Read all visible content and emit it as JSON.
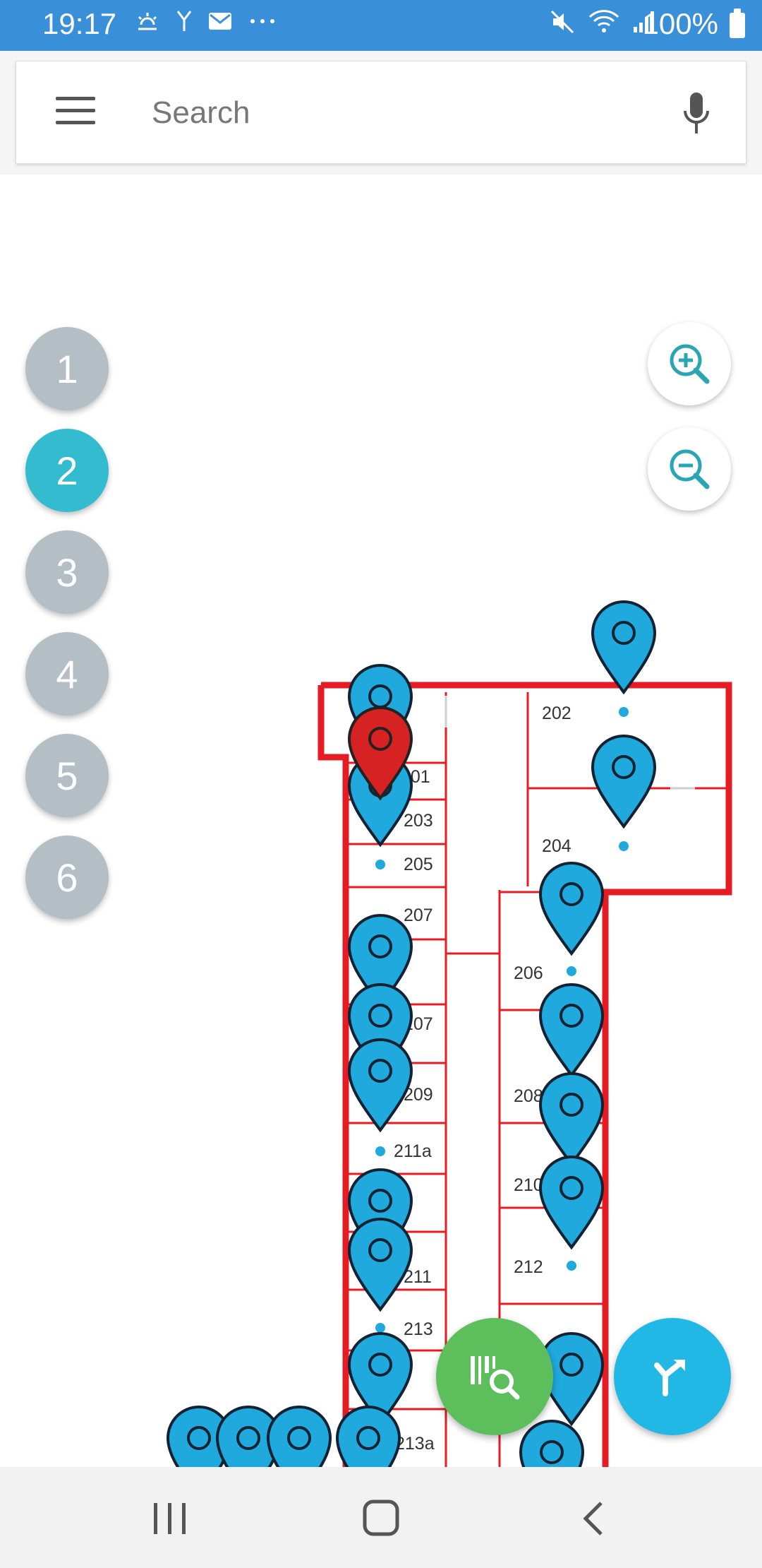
{
  "status_bar": {
    "time": "19:17",
    "battery": "100%",
    "icons": [
      "weather-icon",
      "signal-y-icon",
      "mail-icon",
      "more-icon",
      "mute-icon",
      "wifi-icon",
      "cell-signal-icon",
      "battery-icon"
    ]
  },
  "search": {
    "placeholder": "Search"
  },
  "floors": [
    "1",
    "2",
    "3",
    "4",
    "5",
    "6"
  ],
  "active_floor": "2",
  "map": {
    "rooms": [
      "202",
      "204",
      "201",
      "203",
      "205",
      "207",
      "206",
      "207",
      "208",
      "209",
      "211a",
      "210",
      "212",
      "211",
      "213",
      "213a"
    ]
  },
  "colors": {
    "accent": "#33bccf",
    "pin_blue": "#1fa9dd",
    "pin_red": "#d62222",
    "wall_red": "#e51c23",
    "fab_green": "#5cbf5c",
    "fab_blue": "#22b8e6"
  }
}
